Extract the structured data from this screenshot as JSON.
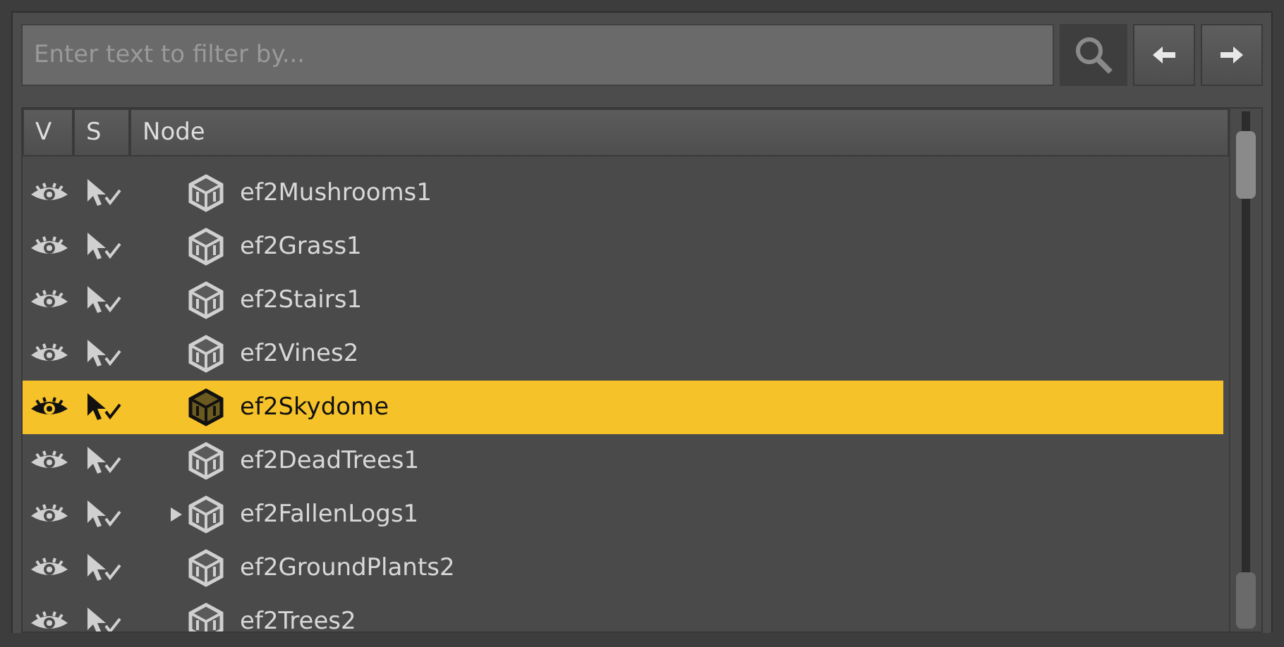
{
  "filter": {
    "placeholder": "Enter text to filter by..."
  },
  "columns": [
    "V",
    "S",
    "Node"
  ],
  "rows": [
    {
      "name": "ef2Mushrooms1",
      "selected": false,
      "expandable": false
    },
    {
      "name": "ef2Grass1",
      "selected": false,
      "expandable": false
    },
    {
      "name": "ef2Stairs1",
      "selected": false,
      "expandable": false
    },
    {
      "name": "ef2Vines2",
      "selected": false,
      "expandable": false
    },
    {
      "name": "ef2Skydome",
      "selected": true,
      "expandable": false
    },
    {
      "name": "ef2DeadTrees1",
      "selected": false,
      "expandable": false
    },
    {
      "name": "ef2FallenLogs1",
      "selected": false,
      "expandable": true
    },
    {
      "name": "ef2GroundPlants2",
      "selected": false,
      "expandable": false
    },
    {
      "name": "ef2Trees2",
      "selected": false,
      "expandable": false
    }
  ]
}
